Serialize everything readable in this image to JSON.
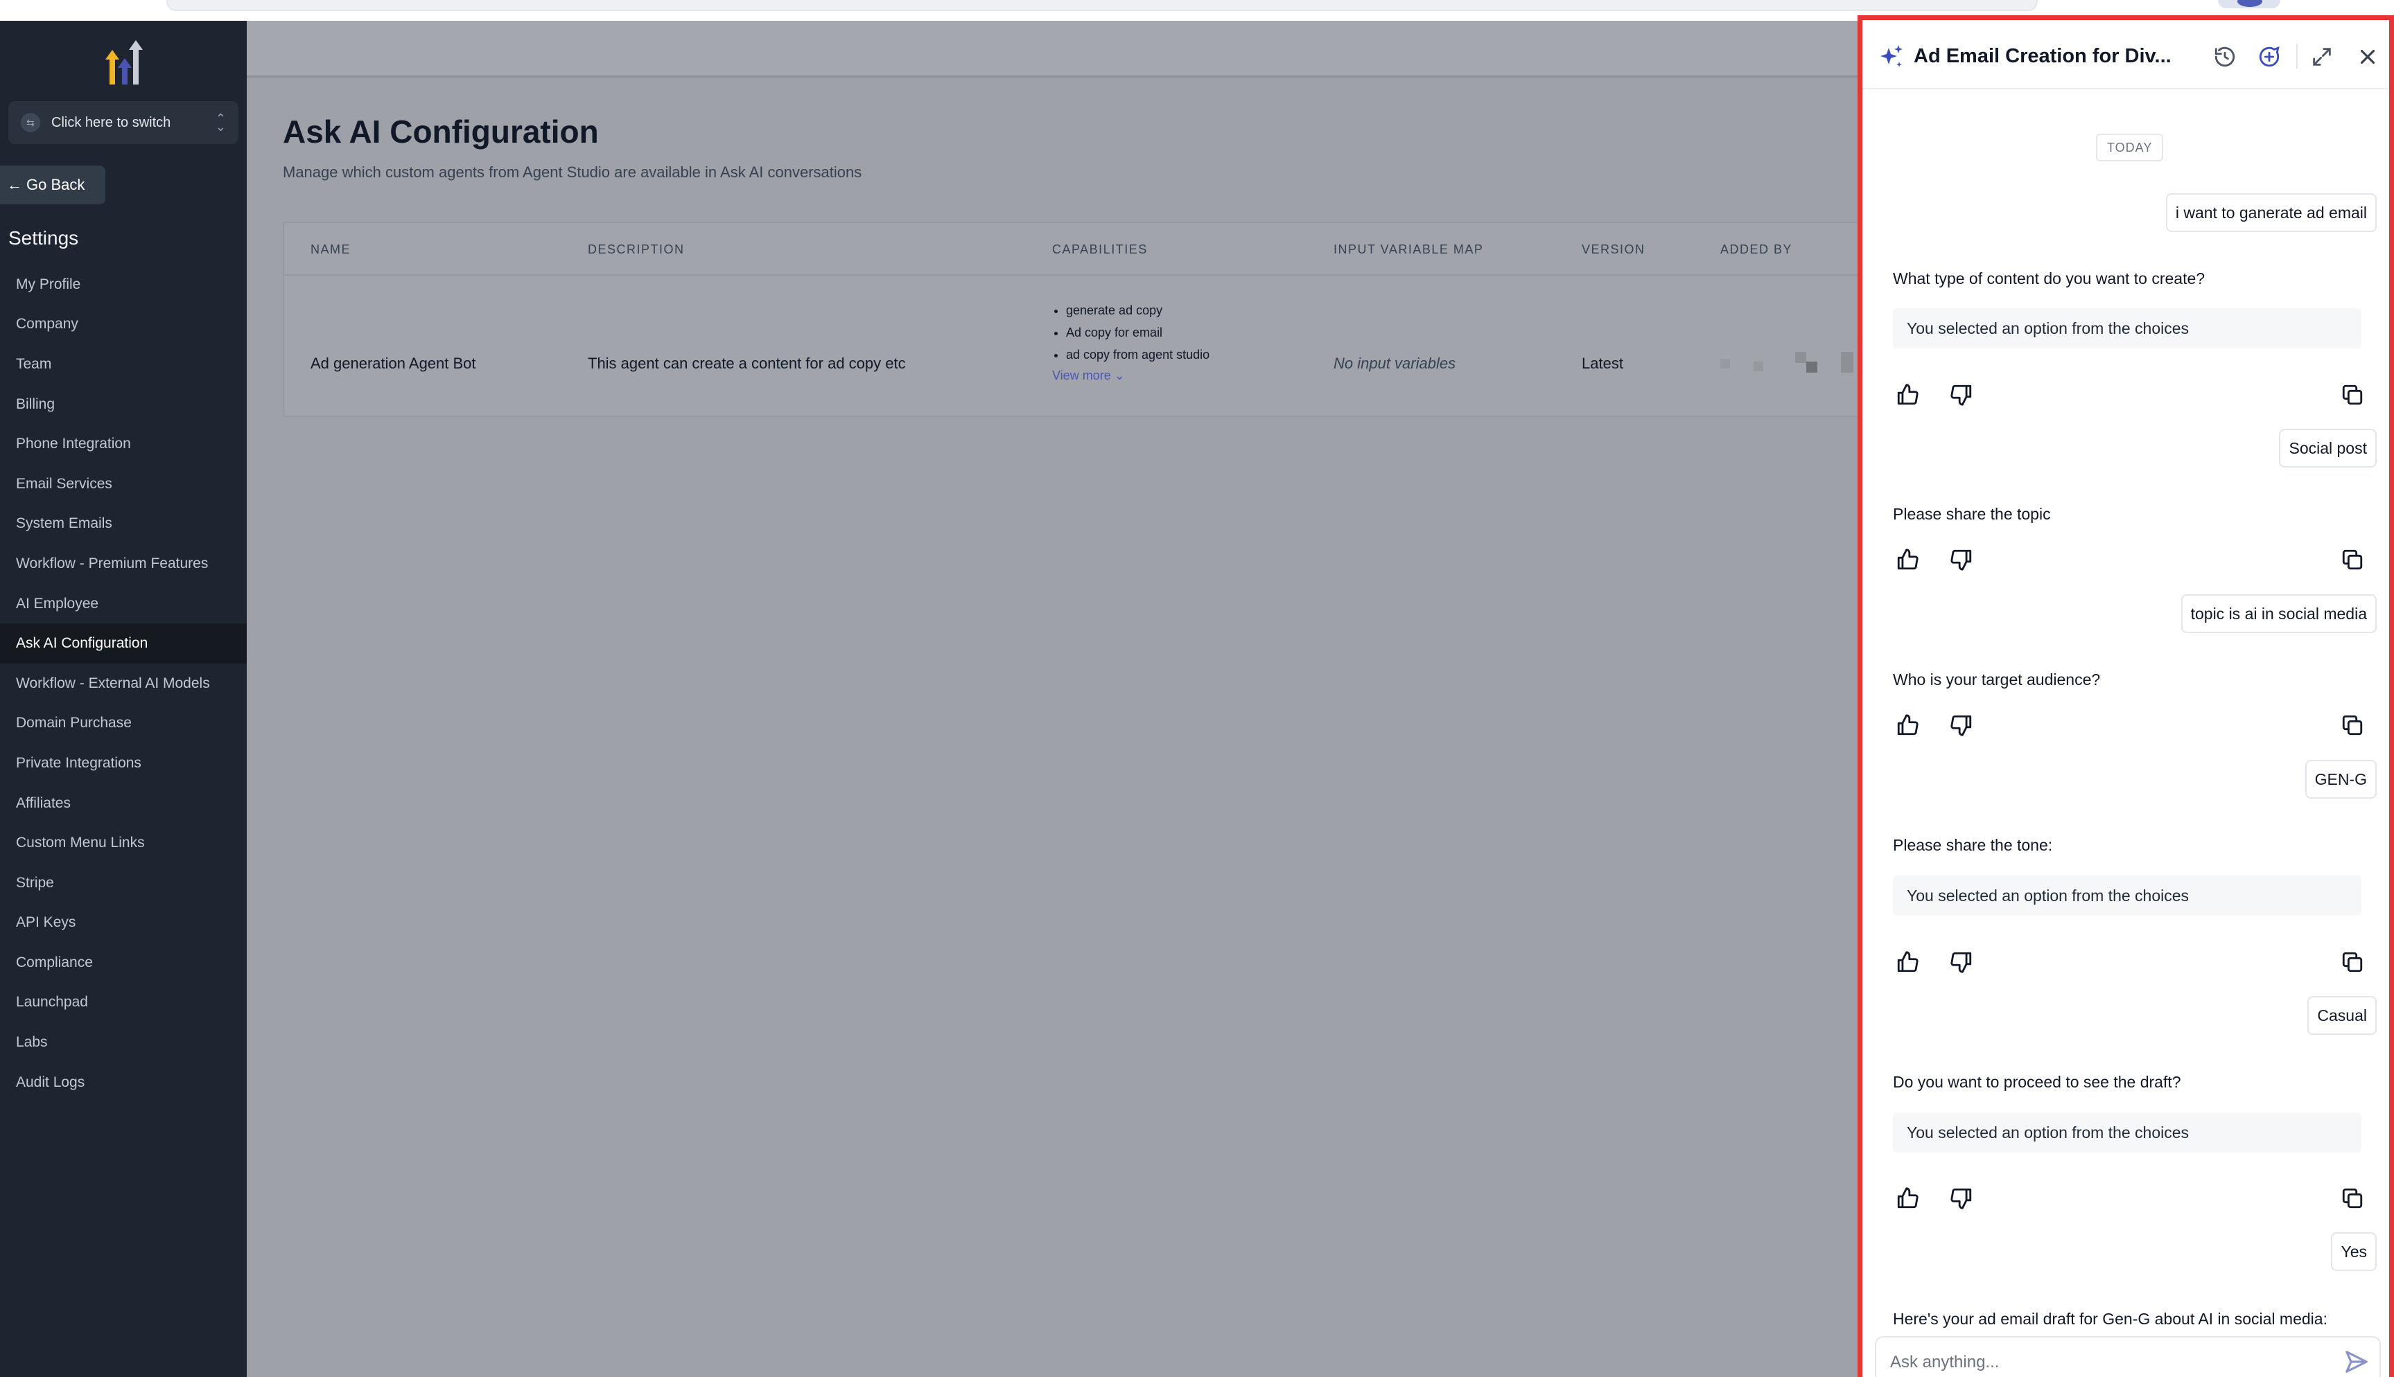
{
  "sidebar": {
    "switcher_label": "Click here to switch",
    "go_back": "Go Back",
    "title": "Settings",
    "items": [
      {
        "label": "My Profile"
      },
      {
        "label": "Company"
      },
      {
        "label": "Team"
      },
      {
        "label": "Billing"
      },
      {
        "label": "Phone Integration"
      },
      {
        "label": "Email Services"
      },
      {
        "label": "System Emails"
      },
      {
        "label": "Workflow - Premium Features"
      },
      {
        "label": "AI Employee"
      },
      {
        "label": "Ask AI Configuration",
        "active": true
      },
      {
        "label": "Workflow - External AI Models"
      },
      {
        "label": "Domain Purchase"
      },
      {
        "label": "Private Integrations"
      },
      {
        "label": "Affiliates"
      },
      {
        "label": "Custom Menu Links"
      },
      {
        "label": "Stripe"
      },
      {
        "label": "API Keys"
      },
      {
        "label": "Compliance"
      },
      {
        "label": "Launchpad"
      },
      {
        "label": "Labs"
      },
      {
        "label": "Audit Logs"
      }
    ]
  },
  "main": {
    "title": "Ask AI Configuration",
    "subtitle": "Manage which custom agents from Agent Studio are available in Ask AI conversations",
    "table": {
      "headers": [
        "NAME",
        "DESCRIPTION",
        "CAPABILITIES",
        "INPUT VARIABLE MAP",
        "VERSION",
        "ADDED BY"
      ],
      "row": {
        "name": "Ad generation Agent Bot",
        "description": "This agent can create a content for ad copy etc",
        "capabilities": [
          "generate ad copy",
          "Ad copy for email",
          "ad copy from agent studio"
        ],
        "view_more": "View more",
        "input_vars": "No input variables",
        "version": "Latest"
      }
    }
  },
  "panel": {
    "title": "Ad Email Creation for Div...",
    "today": "TODAY",
    "messages": {
      "u1": "i want to ganerate ad email",
      "q1": "What type of content do you want to create?",
      "c1": "You selected an option from the choices",
      "u2": "Social post",
      "q2": "Please share the topic",
      "u3": "topic is ai in social media",
      "q3": "Who is your target audience?",
      "u4": "GEN-G",
      "q4": "Please share the tone:",
      "c2": "You selected an option from the choices",
      "u5": "Casual",
      "q5": "Do you want to proceed to see the draft?",
      "c3": "You selected an option from the choices",
      "u6": "Yes",
      "q6": "Here's your ad email draft for Gen-G about AI in social media:"
    },
    "input_placeholder": "Ask anything..."
  },
  "colors": {
    "sidebar_bg": "#1e2530",
    "accent": "#4a55b0",
    "panel_border": "#e53535"
  }
}
